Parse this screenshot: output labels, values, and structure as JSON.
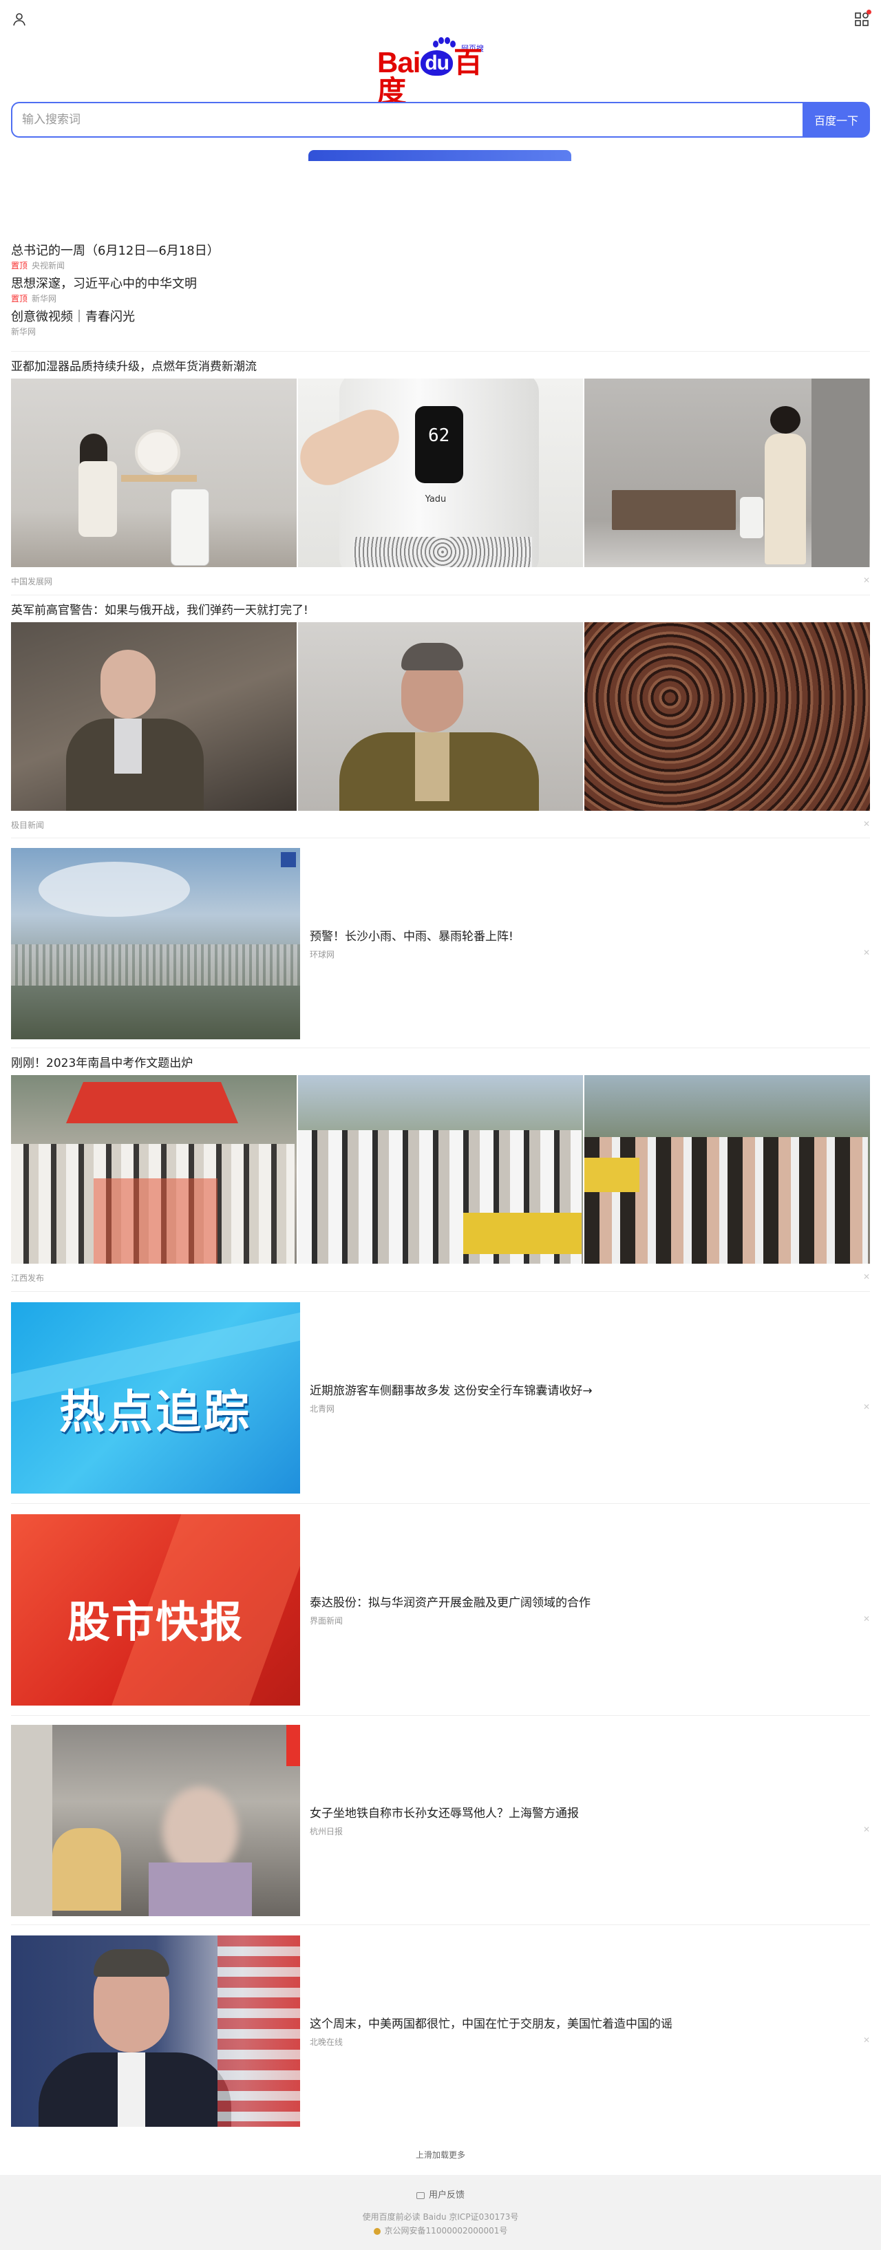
{
  "logo": {
    "bai": "Bai",
    "du": "du",
    "cn": "百度",
    "sub": "网页搜"
  },
  "search": {
    "placeholder": "输入搜索词",
    "button": "百度一下"
  },
  "hot": [
    {
      "title": "总书记的一周（6月12日—6月18日）",
      "tag": "置顶",
      "source": "央视新闻"
    },
    {
      "title": "思想深邃，习近平心中的中华文明",
      "tag": "置顶",
      "source": "新华网"
    },
    {
      "title": "创意微视频｜青春闪光",
      "tag": "",
      "source": "新华网"
    }
  ],
  "feed": [
    {
      "type": "three",
      "title": "亚都加湿器品质持续升级，点燃年货消费新潮流",
      "source": "中国发展网"
    },
    {
      "type": "three",
      "title": "英军前高官警告：如果与俄开战，我们弹药一天就打完了!",
      "source": "极目新闻"
    },
    {
      "type": "single",
      "title": "预警！长沙小雨、中雨、暴雨轮番上阵!",
      "source": "环球网"
    },
    {
      "type": "three",
      "title": "刚刚！2023年南昌中考作文题出炉",
      "source": "江西发布"
    },
    {
      "type": "single",
      "title": "近期旅游客车侧翻事故多发 这份安全行车锦囊请收好→",
      "source": "北青网",
      "img_text": "热点追踪"
    },
    {
      "type": "single",
      "title": "泰达股份：拟与华润资产开展金融及更广阔领域的合作",
      "source": "界面新闻",
      "img_text": "股市快报"
    },
    {
      "type": "single",
      "title": "女子坐地铁自称市长孙女还辱骂他人？上海警方通报",
      "source": "杭州日报"
    },
    {
      "type": "single",
      "title": "这个周末，中美两国都很忙，中国在忙于交朋友，美国忙着造中国的谣",
      "source": "北晚在线"
    }
  ],
  "photo_labels": {
    "meter": "62",
    "brand": "Yadu"
  },
  "loadmore": "上滑加载更多",
  "footer": {
    "feedback": "用户反馈",
    "license": "使用百度前必读 Baidu 京ICP证030173号",
    "police": "京公网安备11000002000001号"
  },
  "colors": {
    "accent": "#4e6ef2",
    "tag": "#f73131",
    "logo_red": "#e10602",
    "logo_blue": "#2319dc"
  }
}
